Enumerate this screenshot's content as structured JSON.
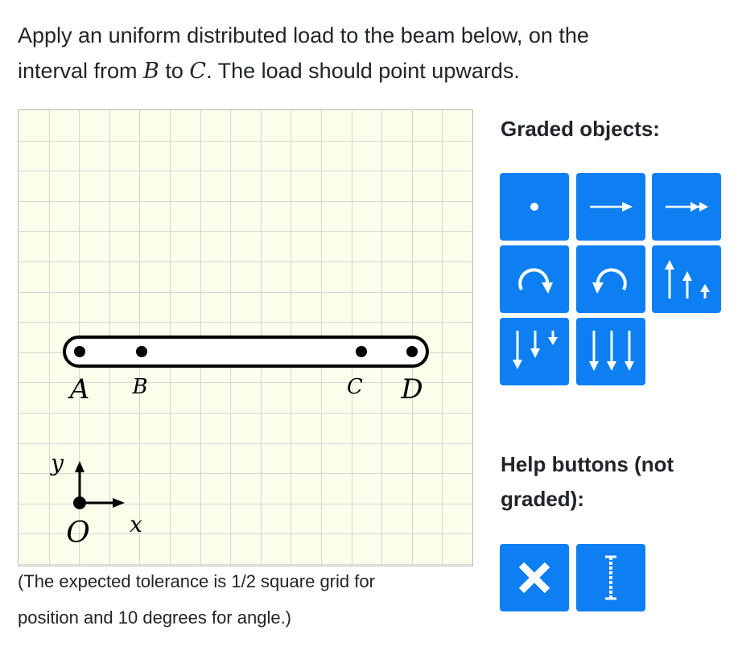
{
  "prompt": {
    "line1": "Apply an uniform distributed load to the beam below, on the",
    "line2_prefix": "interval from ",
    "from_point": "B",
    "line2_mid": " to ",
    "to_point": "C",
    "line2_suffix": ". The load should point upwards."
  },
  "canvas": {
    "point_labels": {
      "A": "A",
      "B": "B",
      "C": "C",
      "D": "D",
      "O": "O"
    },
    "axis_labels": {
      "x": "x",
      "y": "y"
    },
    "background_color": "#fcfdea",
    "grid_color": "#d6d6d6"
  },
  "tolerance": {
    "line1": "(The expected tolerance is 1/2 square grid for",
    "line2": "position and 10 degrees for angle.)"
  },
  "graded_panel": {
    "heading": "Graded objects:",
    "buttons": [
      {
        "icon": "point-icon"
      },
      {
        "icon": "vector-icon"
      },
      {
        "icon": "double-headed-vector-icon"
      },
      {
        "icon": "clockwise-arc-icon"
      },
      {
        "icon": "counterclockwise-arc-icon"
      },
      {
        "icon": "triangular-load-up-icon"
      },
      {
        "icon": "triangular-load-down-icon"
      },
      {
        "icon": "uniform-load-down-icon"
      }
    ]
  },
  "help_panel": {
    "heading_line1": "Help buttons (not",
    "heading_line2": "graded):",
    "buttons": [
      {
        "icon": "delete-icon"
      },
      {
        "icon": "help-line-icon"
      }
    ]
  },
  "colors": {
    "button_blue": "#0d7ff2",
    "text": "#212529"
  }
}
